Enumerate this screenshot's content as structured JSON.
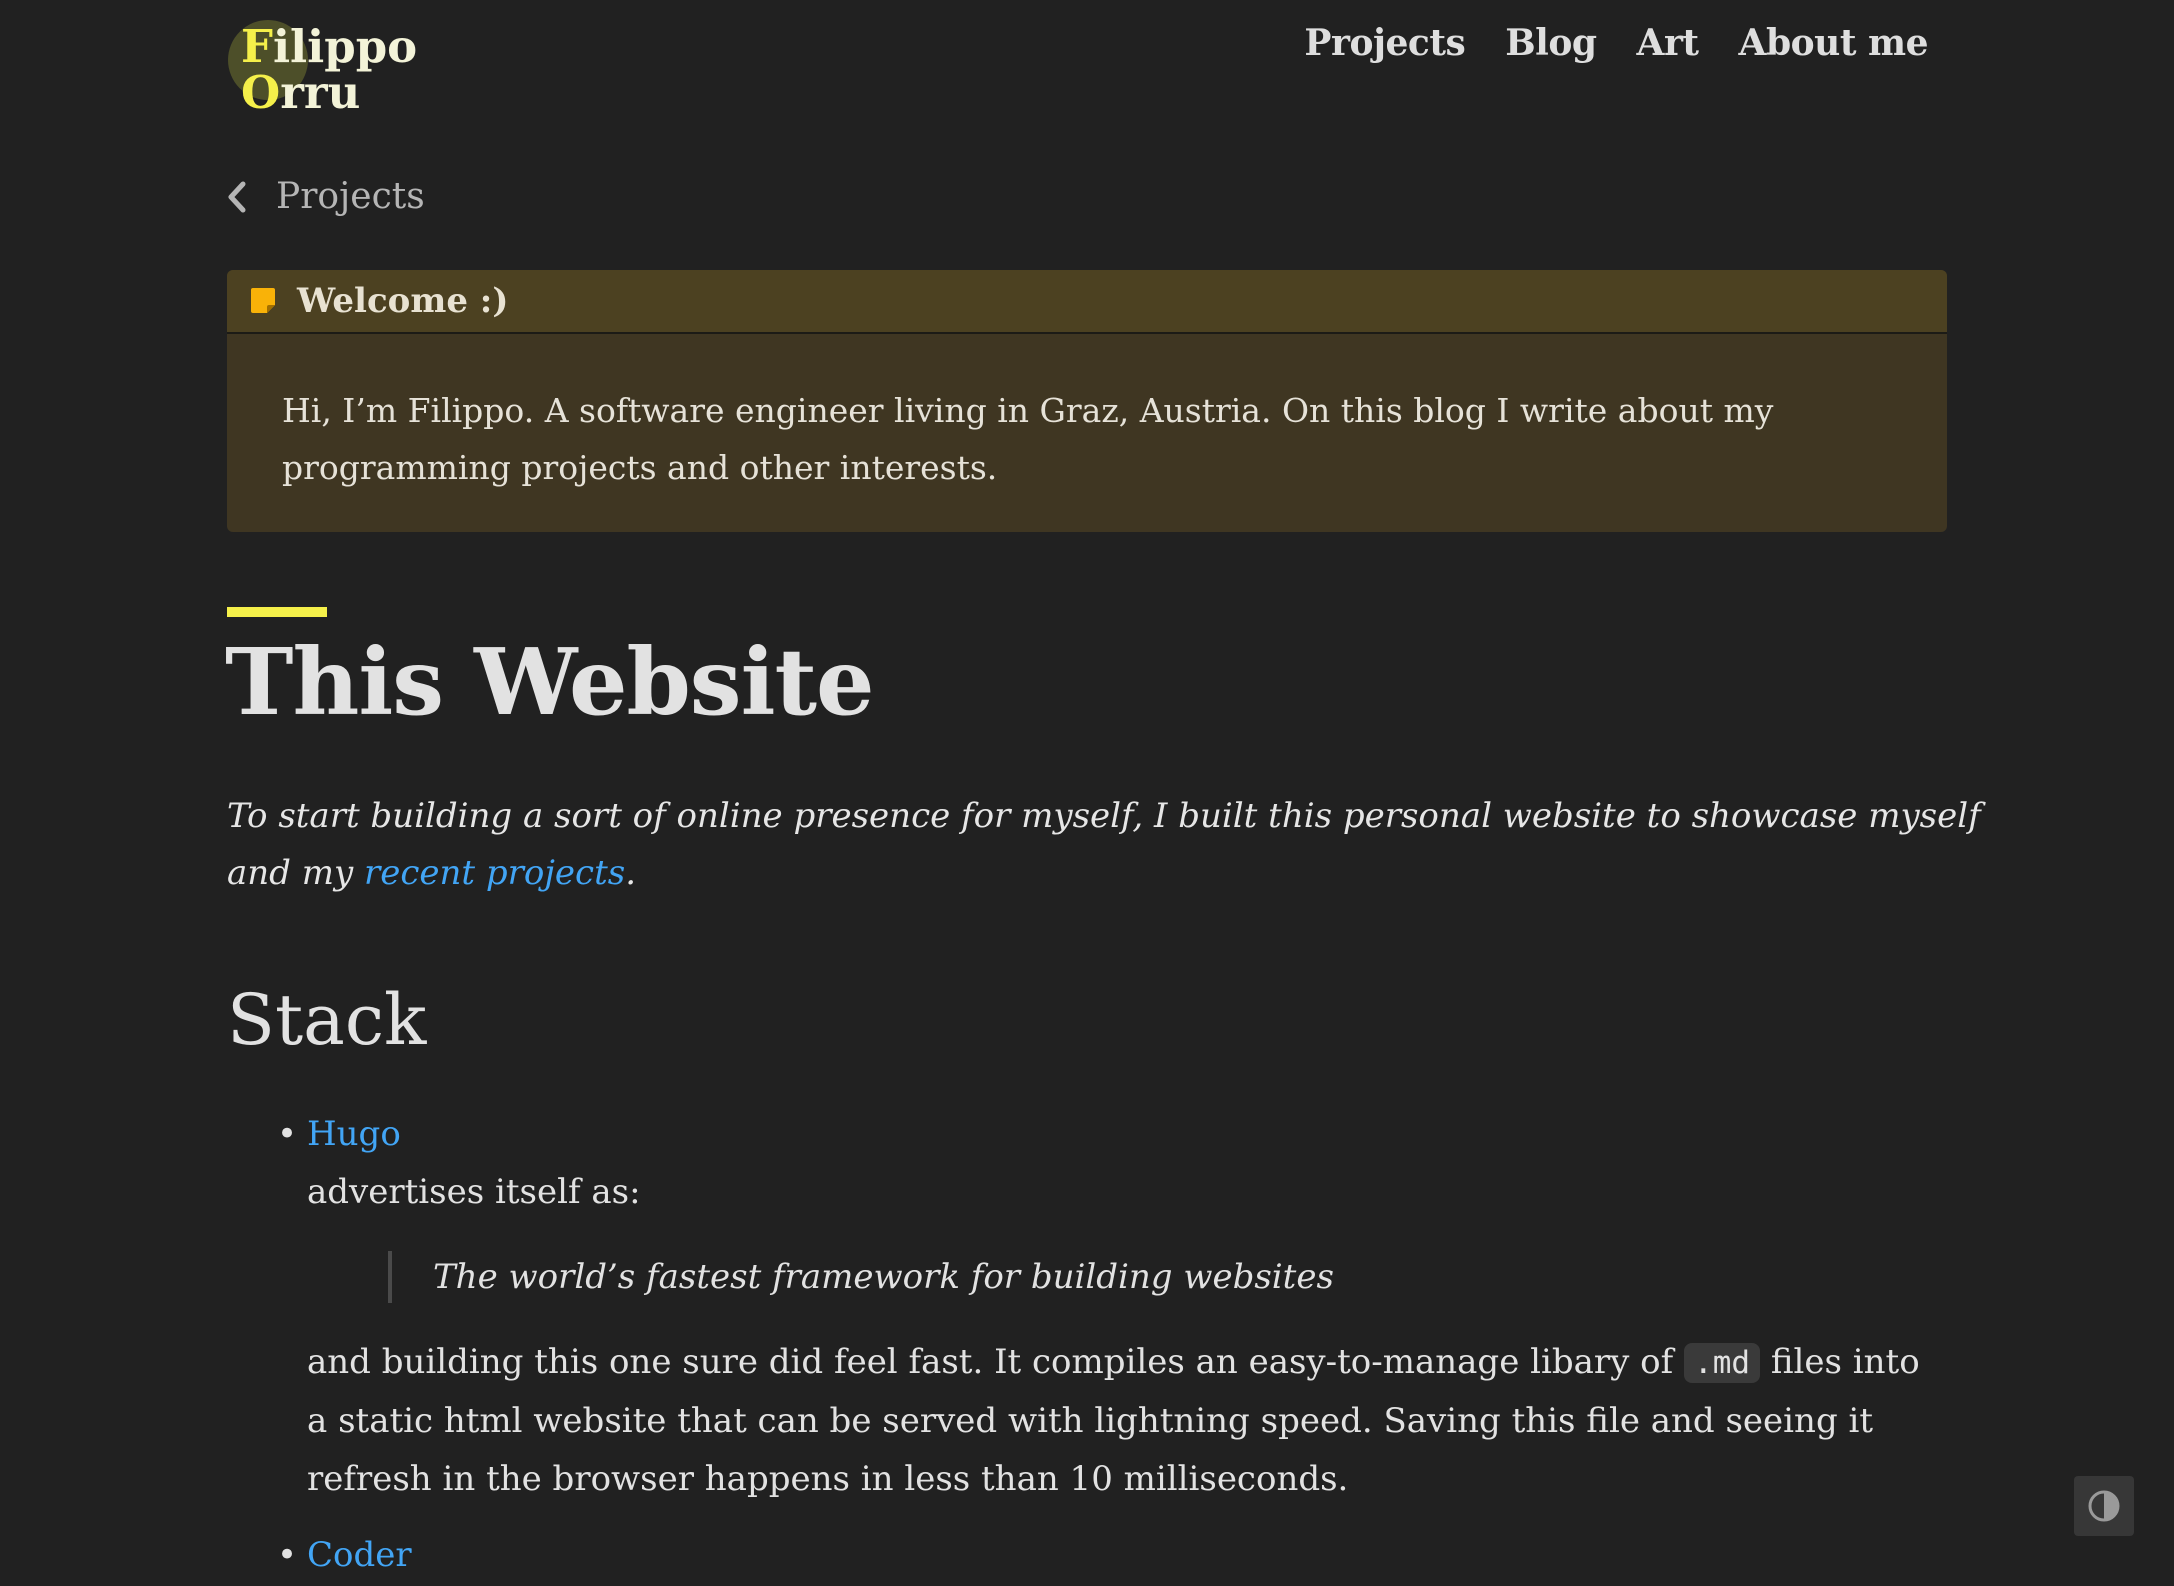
{
  "header": {
    "logo": {
      "line1_first": "F",
      "line1_rest": "ilippo",
      "line2_first": "O",
      "line2_rest": "rru"
    },
    "nav": [
      "Projects",
      "Blog",
      "Art",
      "About me"
    ]
  },
  "breadcrumb": {
    "back_label": "Projects"
  },
  "callout": {
    "title": "Welcome :)",
    "body": "Hi, I’m Filippo. A software engineer living in Graz, Austria. On this blog I write about my programming projects and other interests."
  },
  "article": {
    "title": "This Website",
    "intro_text": "To start building a sort of online presence for myself, I built this personal website to showcase myself and my ",
    "intro_link": "recent projects",
    "intro_end": ".",
    "section_heading": "Stack",
    "items": [
      {
        "link": "Hugo",
        "after_link": "advertises itself as:",
        "quote": "The world’s fastest framework for building websites",
        "text_before_code": "and building this one sure did feel fast. It compiles an easy-to-manage libary of ",
        "code": ".md",
        "text_after_code": " files into a static html website that can be served with lightning speed. Saving this file and seeing it refresh in the browser happens in less than 10 milliseconds."
      },
      {
        "link": "Coder"
      }
    ]
  },
  "colors": {
    "background": "#212121",
    "accent": "#f5f04a",
    "link": "#42a5f5",
    "callout_bg": "#3f3622",
    "callout_header": "#4c4121",
    "callout_icon": "#f9b208"
  },
  "icons": {
    "back": "chevron-left-icon",
    "callout": "sticky-note-icon",
    "theme_toggle": "contrast-icon"
  }
}
